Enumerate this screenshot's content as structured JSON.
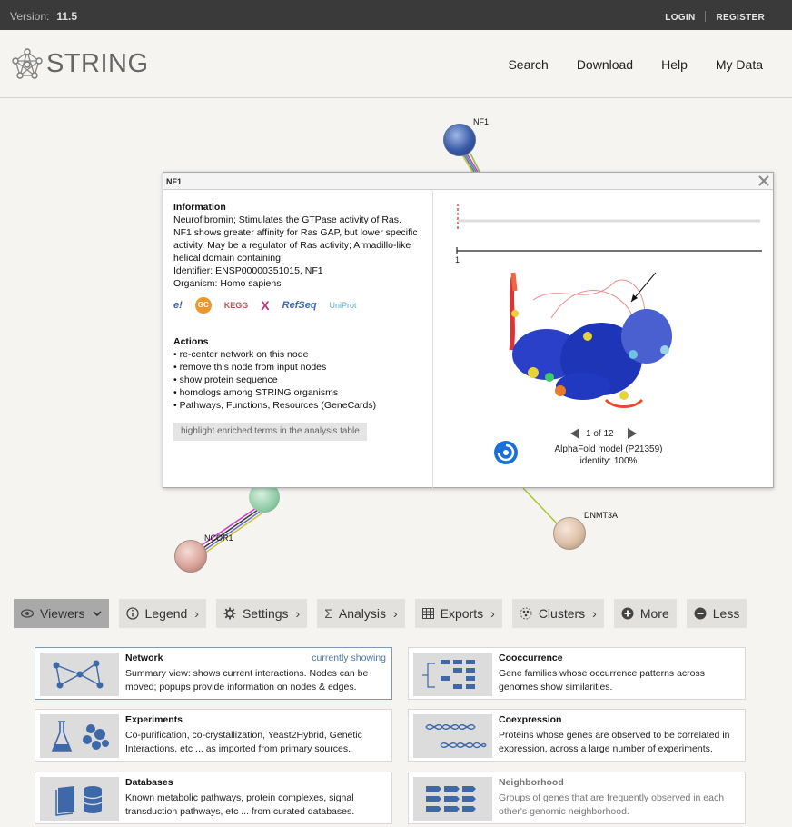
{
  "topbar": {
    "version_label": "Version:",
    "version": "11.5",
    "login": "LOGIN",
    "register": "REGISTER"
  },
  "header": {
    "logo_text": "STRING",
    "nav": [
      "Search",
      "Download",
      "Help",
      "My Data"
    ]
  },
  "network": {
    "nodes": [
      {
        "label": "NF1",
        "color": "#3a5ba8"
      },
      {
        "label": "NCOR1",
        "color": "#d9a49a"
      },
      {
        "label": "DNMT3A",
        "color": "#dcc0a8"
      }
    ]
  },
  "popup": {
    "title": "NF1",
    "info_heading": "Information",
    "description": "Neurofibromin; Stimulates the GTPase activity of Ras. NF1 shows greater affinity for Ras GAP, but lower specific activity. May be a regulator of Ras activity; Armadillo-like helical domain containing",
    "identifier": "Identifier: ENSP00000351015, NF1",
    "organism": "Organism: Homo sapiens",
    "db_logos": [
      "e!",
      "GC",
      "KEGG",
      "X",
      "RefSeq",
      "UniProt"
    ],
    "actions_heading": "Actions",
    "actions": [
      "• re-center network on this node",
      "• remove this node from input nodes",
      "• show protein sequence",
      "• homologs among STRING organisms",
      "• Pathways, Functions, Resources (GeneCards)"
    ],
    "highlight_button": "highlight enriched terms in the analysis table",
    "sequence_start": "1",
    "structure_pager": "1 of 12",
    "structure_model": "AlphaFold model (P21359)",
    "structure_identity": "identity: 100%"
  },
  "toolbar": [
    {
      "label": "Viewers",
      "icon": "eye-icon",
      "chevron": "⌄",
      "active": true
    },
    {
      "label": "Legend",
      "icon": "info-icon",
      "chevron": "›"
    },
    {
      "label": "Settings",
      "icon": "gear-icon",
      "chevron": "›"
    },
    {
      "label": "Analysis",
      "icon": "sigma-icon",
      "chevron": "›"
    },
    {
      "label": "Exports",
      "icon": "table-icon",
      "chevron": "›"
    },
    {
      "label": "Clusters",
      "icon": "cluster-icon",
      "chevron": "›"
    },
    {
      "label": "More",
      "icon": "plus-circle-icon",
      "chevron": ""
    },
    {
      "label": "Less",
      "icon": "minus-circle-icon",
      "chevron": ""
    }
  ],
  "viewers": [
    {
      "title": "Network",
      "status": "currently showing",
      "desc": "Summary view: shows current interactions. Nodes can be moved; popups provide information on nodes & edges."
    },
    {
      "title": "Cooccurrence",
      "desc": "Gene families whose occurrence patterns across genomes show similarities."
    },
    {
      "title": "Experiments",
      "desc": "Co-purification, co-crystallization, Yeast2Hybrid, Genetic Interactions, etc ... as imported from primary sources."
    },
    {
      "title": "Coexpression",
      "desc": "Proteins whose genes are observed to be correlated in expression, across a large number of experiments."
    },
    {
      "title": "Databases",
      "desc": "Known metabolic pathways, protein complexes, signal transduction pathways, etc ... from curated databases."
    },
    {
      "title": "Neighborhood",
      "desc": "Groups of genes that are frequently observed in each other's genomic neighborhood."
    }
  ]
}
